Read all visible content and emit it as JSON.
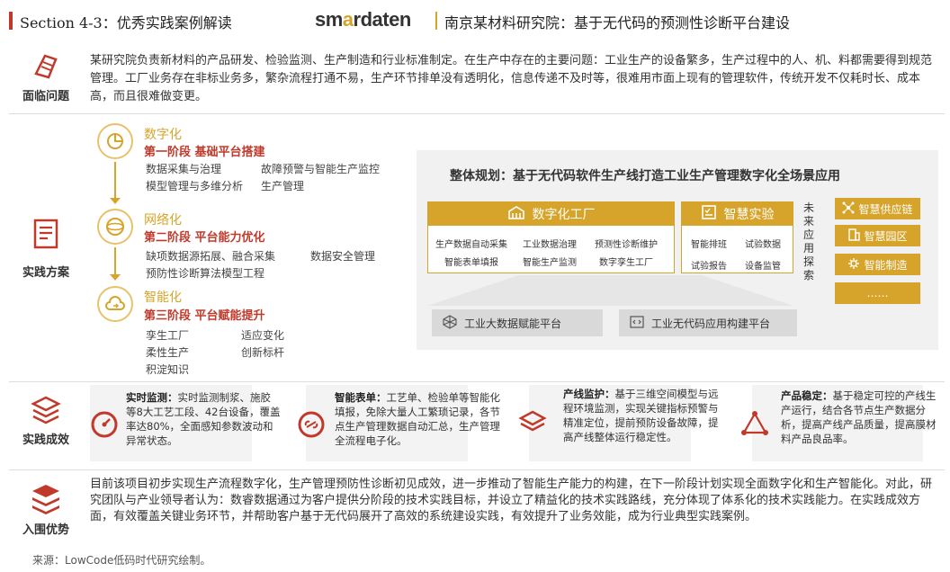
{
  "header": {
    "section": "Section 4-3：优秀实践案例解读",
    "logo_main": "sm",
    "logo_accent": "a",
    "logo_rest": "rdaten",
    "project": "南京某材料研究院：基于无代码的预测性诊断平台建设"
  },
  "problem": {
    "label": "面临问题",
    "text": "某研究院负责新材料的产品研发、检验监测、生产制造和行业标准制定。在生产中存在的主要问题：工业生产的设备繁多，生产过程中的人、机、料都需要得到规范管理。工厂业务存在非标业务多，繁杂流程打通不易，生产环节排单没有透明化，信息传递不及时等，很难用市面上现有的管理软件，传统开发不仅耗时长、成本高，而且很难做变更。"
  },
  "practice": {
    "label": "实践方案",
    "stages": [
      {
        "title": "数字化",
        "subtitle": "第一阶段  基础平台搭建",
        "items": [
          "数据采集与治理",
          "故障预警与智能生产监控",
          "模型管理与多维分析",
          "生产管理"
        ]
      },
      {
        "title": "网络化",
        "subtitle": "第二阶段  平台能力优化",
        "items": [
          "缺项数据源拓展、融合采集",
          "数据安全管理",
          "预防性诊断算法模型工程"
        ]
      },
      {
        "title": "智能化",
        "subtitle": "第三阶段  平台赋能提升",
        "items": [
          "孪生工厂",
          "适应变化",
          "柔性生产",
          "创新标杆",
          "积淀知识"
        ]
      }
    ],
    "plan": {
      "title": "整体规划：基于无代码软件生产线打造工业生产管理数字化全场景应用",
      "factory": {
        "title": "数字化工厂",
        "items": [
          "生产数据自动采集",
          "工业数据治理",
          "预测性诊断维护",
          "智能表单填报",
          "智能生产监测",
          "数字孪生工厂"
        ]
      },
      "lab": {
        "title": "智慧实验",
        "items": [
          "智能排班",
          "试验数据",
          "试验报告",
          "设备监管"
        ]
      },
      "vertical": "未来应用探索",
      "apps": [
        "智慧供应链",
        "智慧园区",
        "智能制造",
        "……"
      ],
      "platforms": [
        "工业大数据赋能平台",
        "工业无代码应用构建平台"
      ]
    }
  },
  "results": {
    "label": "实践成效",
    "cards": [
      {
        "title": "实时监测：",
        "body": "实时监测制浆、施胶等8大工艺工段、42台设备，覆盖率达80%，全面感知参数波动和异常状态。"
      },
      {
        "title": "智能表单：",
        "body": "工艺单、检验单等智能化填报，免除大量人工繁琐记录，各节点生产管理数据自动汇总，生产管理全流程电子化。"
      },
      {
        "title": "产线监护：",
        "body": "基于三维空间模型与远程环境监测，实现关键指标预警与精准定位，提前预防设备故障，提高产线整体运行稳定性。"
      },
      {
        "title": "产品稳定：",
        "body": "基于稳定可控的产线生产运行，结合各节点生产数据分析，提高产线产品质量，提高膜材料产品良品率。"
      }
    ]
  },
  "advantage": {
    "label": "入围优势",
    "text": "目前该项目初步实现生产流程数字化，生产管理预防性诊断初见成效，进一步推动了智能生产能力的构建，在下一阶段计划实现全面数字化和生产智能化。对此，研究团队与产业领导者认为：数睿数据通过为客户提供分阶段的技术实践目标，并设立了精益化的技术实践路线，充分体现了体系化的技术实践能力。在实践成效方面，有效覆盖关键业务环节，并帮助客户基于无代码展开了高效的系统建设实践，有效提升了业务效能，成为行业典型实践案例。"
  },
  "source": "来源：LowCode低码时代研究绘制。",
  "colors": {
    "gold": "#d6a42a",
    "red": "#c0392b",
    "grey": "#f1f1f1"
  }
}
